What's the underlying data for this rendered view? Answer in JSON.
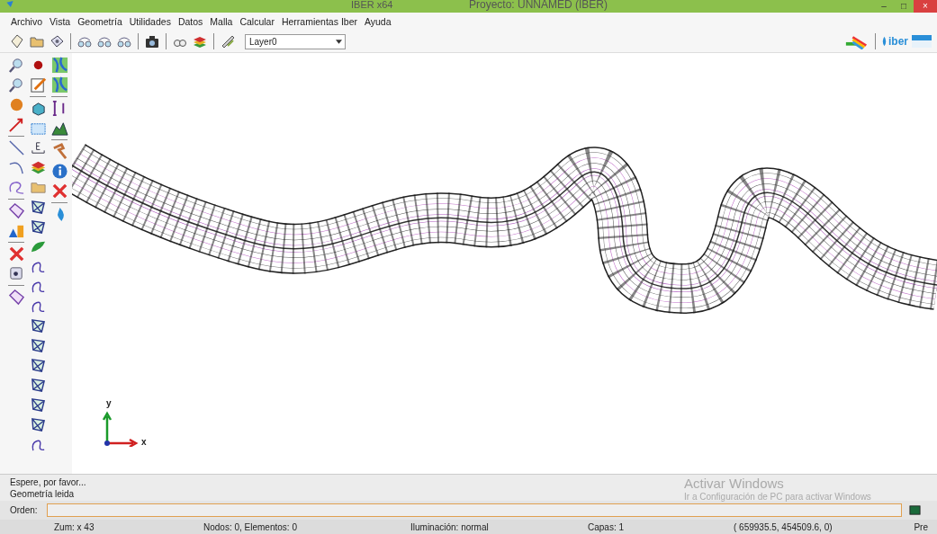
{
  "window": {
    "app_title": "IBER x64",
    "title": "Proyecto: UNNAMED (IBER)",
    "controls": [
      "–",
      "□",
      "×"
    ]
  },
  "menu": [
    "Archivo",
    "Vista",
    "Geometría",
    "Utilidades",
    "Datos",
    "Malla",
    "Calcular",
    "Herramientas Iber",
    "Ayuda"
  ],
  "toolbar": {
    "layer_select": {
      "value": "Layer0"
    },
    "logo": {
      "text": "iber"
    }
  },
  "canvas": {
    "axes": {
      "y_label": "y",
      "x_label": "x"
    }
  },
  "messages": [
    "Espere, por favor...",
    "Geometría leida"
  ],
  "command": {
    "label": "Orden:"
  },
  "activation_notice": {
    "title": "Activar Windows",
    "text": "Ir a Configuración de PC para activar Windows"
  },
  "status_bar": [
    "Zum: x 43",
    "Nodos: 0, Elementos: 0",
    "Iluminación: normal",
    "Capas: 1",
    "( 659935.5,  454509.6,  0)",
    "Pre"
  ]
}
